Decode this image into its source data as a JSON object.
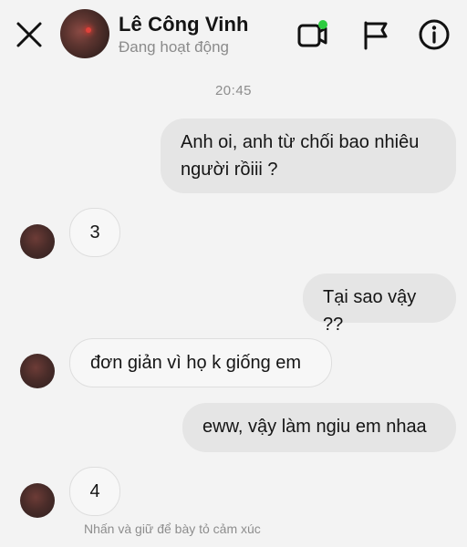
{
  "header": {
    "name": "Lê Công Vinh",
    "status": "Đang hoạt động",
    "icons": [
      "close-icon",
      "video-call-icon",
      "flag-icon",
      "info-icon"
    ],
    "online_dot_color": "#2ecc40"
  },
  "conversation": {
    "timestamp": "20:45",
    "messages": [
      {
        "from": "me",
        "lines": [
          "Anh oi, anh từ chối bao nhiêu",
          "người rồiii ?"
        ]
      },
      {
        "from": "them",
        "text": "3"
      },
      {
        "from": "me",
        "text": "Tại sao vậy ??"
      },
      {
        "from": "them",
        "text": "đơn giản vì họ k giống em"
      },
      {
        "from": "me",
        "text": "eww, vậy làm ngiu em nhaa"
      },
      {
        "from": "them",
        "text": "4"
      }
    ],
    "hint": "Nhấn và giữ để bày tỏ cảm xúc"
  }
}
